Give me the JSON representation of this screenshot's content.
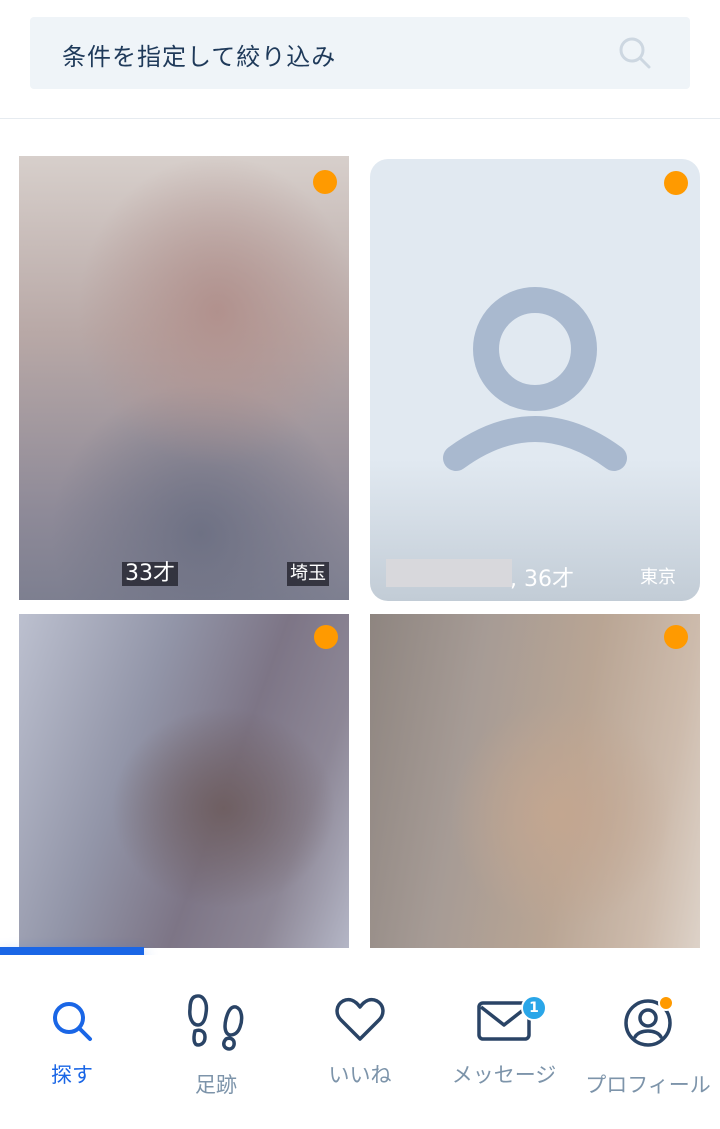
{
  "search": {
    "placeholder": "条件を指定して絞り込み",
    "icon": "search-icon"
  },
  "profiles": [
    {
      "age": "33才",
      "location": "埼玉",
      "online": true,
      "has_photo": true
    },
    {
      "age": ", 36才",
      "location": "東京",
      "online": true,
      "has_photo": false
    },
    {
      "age": "",
      "location": "",
      "online": true,
      "has_photo": true
    },
    {
      "age": "",
      "location": "",
      "online": true,
      "has_photo": true
    }
  ],
  "nav": {
    "items": [
      {
        "label": "探す",
        "icon": "search-icon",
        "active": true
      },
      {
        "label": "足跡",
        "icon": "footprints-icon",
        "active": false
      },
      {
        "label": "いいね",
        "icon": "heart-icon",
        "active": false
      },
      {
        "label": "メッセージ",
        "icon": "mail-icon",
        "active": false,
        "badge": "1"
      },
      {
        "label": "プロフィール",
        "icon": "profile-icon",
        "active": false
      }
    ]
  },
  "colors": {
    "accent": "#1a66e6",
    "online_dot": "#ff9a00",
    "badge": "#2aa6e8",
    "nav_inactive": "#7d94aa"
  }
}
